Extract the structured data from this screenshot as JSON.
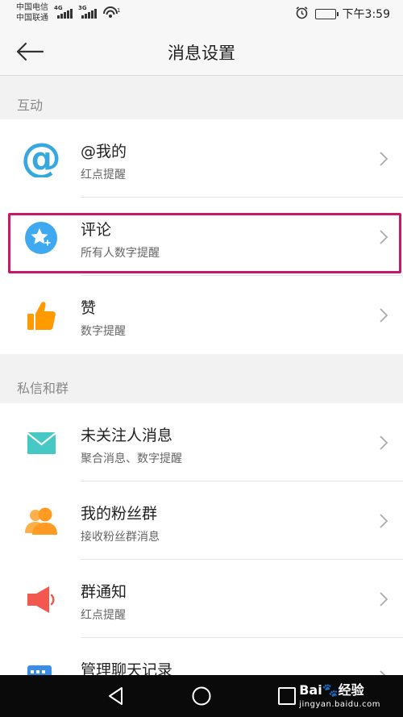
{
  "status_bar": {
    "carrier_1": "中国电信",
    "carrier_2": "中国联通",
    "network_1": "4G",
    "network_2": "3G",
    "wifi_badge": "1",
    "time": "下午3:59"
  },
  "nav": {
    "title": "消息设置"
  },
  "sections": [
    {
      "header": "互动",
      "items": [
        {
          "title": "@我的",
          "subtitle": "红点提醒",
          "icon": "at-icon",
          "color": "#35a8e0"
        },
        {
          "title": "评论",
          "subtitle": "所有人数字提醒",
          "icon": "star-comment-icon",
          "color": "#3ea9f0"
        },
        {
          "title": "赞",
          "subtitle": "数字提醒",
          "icon": "thumbs-up-icon",
          "color": "#ff9a00"
        }
      ]
    },
    {
      "header": "私信和群",
      "items": [
        {
          "title": "未关注人消息",
          "subtitle": "聚合消息、数字提醒",
          "icon": "envelope-icon",
          "color": "#46c8c4"
        },
        {
          "title": "我的粉丝群",
          "subtitle": "接收粉丝群消息",
          "icon": "fans-group-icon",
          "color": "#ff9a22"
        },
        {
          "title": "群通知",
          "subtitle": "红点提醒",
          "icon": "speaker-icon",
          "color": "#f2584e"
        },
        {
          "title": "管理聊天记录",
          "subtitle": "",
          "icon": "chat-record-icon",
          "color": "#3a8ee8"
        }
      ]
    }
  ],
  "highlight_color": "#c8186b",
  "watermark": {
    "brand": "Bai",
    "brand_suffix": "经验",
    "domain": "jingyan.baidu.com"
  }
}
